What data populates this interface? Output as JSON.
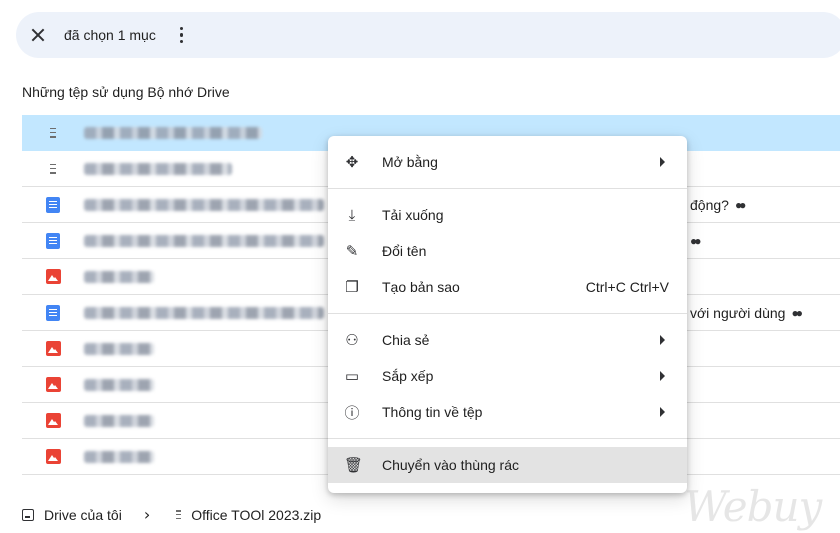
{
  "selection_bar": {
    "count_label": "đã chọn 1 mục"
  },
  "section_title": "Những tệp sử dụng Bộ nhớ Drive",
  "file_rows": [
    {
      "type": "zip-icon",
      "selected": true,
      "right_text": ""
    },
    {
      "type": "zip-icon",
      "selected": false,
      "right_text": ""
    },
    {
      "type": "doc-icon",
      "selected": false,
      "right_text": "động?"
    },
    {
      "type": "doc-icon",
      "selected": false,
      "right_text": ""
    },
    {
      "type": "image-icon",
      "selected": false,
      "right_text": ""
    },
    {
      "type": "doc-icon",
      "selected": false,
      "right_text": "với người dùng"
    },
    {
      "type": "image-icon",
      "selected": false,
      "right_text": ""
    },
    {
      "type": "image-icon",
      "selected": false,
      "right_text": ""
    },
    {
      "type": "image-icon",
      "selected": false,
      "right_text": ""
    },
    {
      "type": "image-icon",
      "selected": false,
      "right_text": ""
    }
  ],
  "context_menu": {
    "open_with": "Mở bằng",
    "download": "Tải xuống",
    "rename": "Đổi tên",
    "make_copy": "Tạo bản sao",
    "make_copy_shortcut": "Ctrl+C Ctrl+V",
    "share": "Chia sẻ",
    "organize": "Sắp xếp",
    "file_info": "Thông tin về tệp",
    "move_to_trash": "Chuyển vào thùng rác"
  },
  "breadcrumb": {
    "root": "Drive của tôi",
    "file": "Office TOOl 2023.zip"
  },
  "watermark": "Webuy",
  "colors": {
    "selected_row": "#c2e7ff",
    "selection_bar": "#edf2fa",
    "doc_blue": "#4285f4",
    "image_red": "#ea4335",
    "menu_highlight": "#e3e3e3"
  }
}
